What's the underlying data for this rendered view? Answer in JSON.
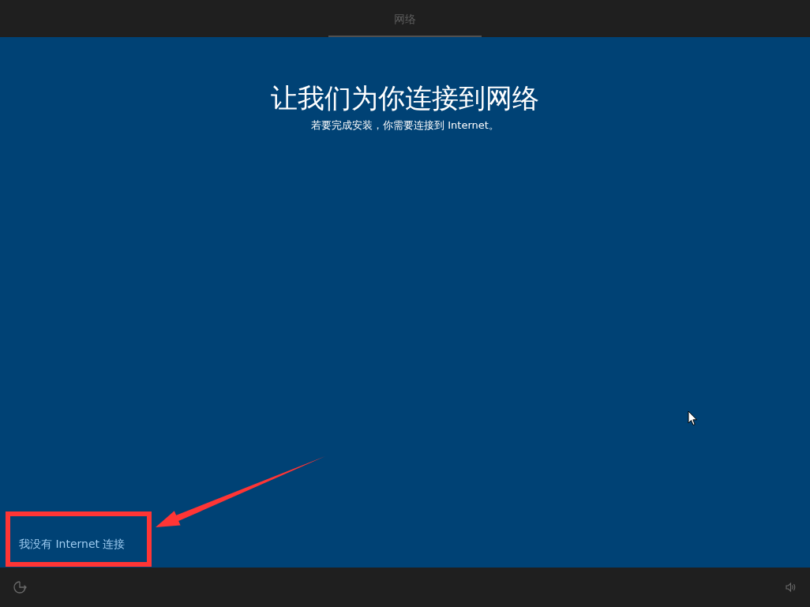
{
  "top_bar": {
    "tabs": [
      {
        "label": "网络",
        "selected": true
      }
    ]
  },
  "page": {
    "title": "让我们为你连接到网络",
    "subtitle": "若要完成安装，你需要连接到 Internet。"
  },
  "skip_link": {
    "label": "我没有 Internet 连接"
  }
}
